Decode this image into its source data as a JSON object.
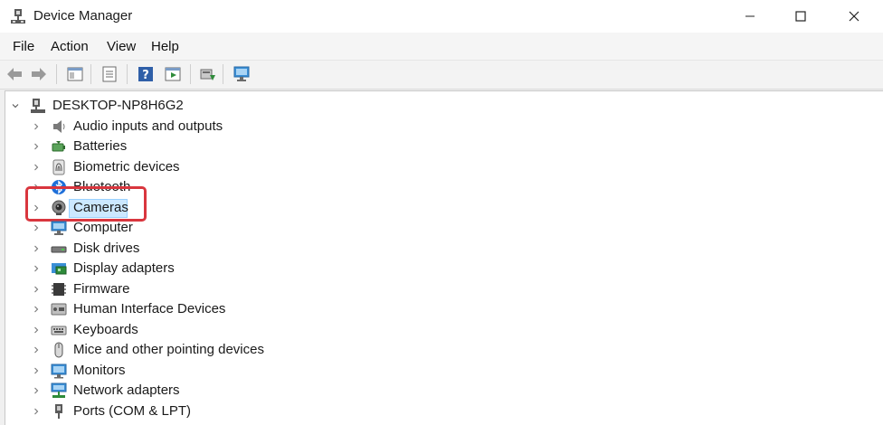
{
  "window": {
    "title": "Device Manager",
    "icon": "device-manager-icon"
  },
  "menu": [
    "File",
    "Action",
    "View",
    "Help"
  ],
  "toolbar": {
    "icons": [
      "back-arrow-icon",
      "forward-arrow-icon",
      "console-tree-icon",
      "properties-icon",
      "help-icon",
      "action-pane-icon",
      "update-driver-icon",
      "monitor-icon"
    ]
  },
  "tree": {
    "root": "DESKTOP-NP8H6G2",
    "items": [
      {
        "label": "Audio inputs and outputs",
        "icon": "speaker-icon"
      },
      {
        "label": "Batteries",
        "icon": "battery-icon"
      },
      {
        "label": "Biometric devices",
        "icon": "fingerprint-icon"
      },
      {
        "label": "Bluetooth",
        "icon": "bluetooth-icon"
      },
      {
        "label": "Cameras",
        "icon": "camera-icon",
        "selected": true
      },
      {
        "label": "Computer",
        "icon": "computer-icon"
      },
      {
        "label": "Disk drives",
        "icon": "disk-drive-icon"
      },
      {
        "label": "Display adapters",
        "icon": "display-adapter-icon"
      },
      {
        "label": "Firmware",
        "icon": "firmware-icon"
      },
      {
        "label": "Human Interface Devices",
        "icon": "hid-icon"
      },
      {
        "label": "Keyboards",
        "icon": "keyboard-icon"
      },
      {
        "label": "Mice and other pointing devices",
        "icon": "mouse-icon"
      },
      {
        "label": "Monitors",
        "icon": "monitor-icon"
      },
      {
        "label": "Network adapters",
        "icon": "network-adapter-icon"
      },
      {
        "label": "Ports (COM & LPT)",
        "icon": "port-icon"
      }
    ]
  },
  "colors": {
    "selection": "#cce8ff",
    "highlight": "#d9363e"
  }
}
